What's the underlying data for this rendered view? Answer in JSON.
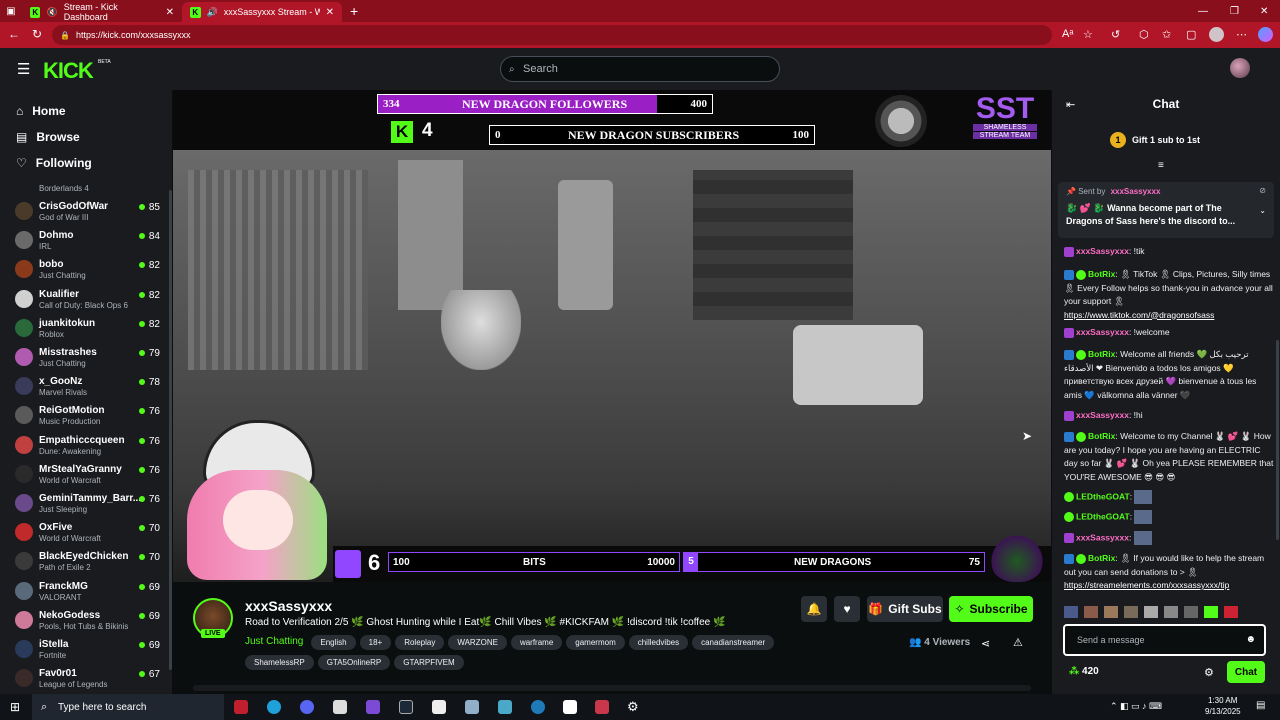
{
  "browser": {
    "tabs": [
      {
        "title": "Stream - Kick Dashboard",
        "active": false
      },
      {
        "title": "xxxSassyxxx Stream - Watch",
        "active": true
      }
    ],
    "url": "https://kick.com/xxxsassyxxx",
    "kick_fav": "K"
  },
  "header": {
    "logo": "KICK",
    "logo_badge": "BETA",
    "search_placeholder": "Search"
  },
  "sidebar": {
    "nav": [
      {
        "label": "Home",
        "icon": "home-icon"
      },
      {
        "label": "Browse",
        "icon": "browse-icon"
      },
      {
        "label": "Following",
        "icon": "heart-icon"
      }
    ],
    "partial_category": "Borderlands 4",
    "channels": [
      {
        "name": "CrisGodOfWar",
        "category": "God of War III",
        "viewers": "85"
      },
      {
        "name": "Dohmo",
        "category": "IRL",
        "viewers": "84"
      },
      {
        "name": "bobo",
        "category": "Just Chatting",
        "viewers": "82"
      },
      {
        "name": "Kualifier",
        "category": "Call of Duty: Black Ops 6",
        "viewers": "82"
      },
      {
        "name": "juankitokun",
        "category": "Roblox",
        "viewers": "82"
      },
      {
        "name": "Misstrashes",
        "category": "Just Chatting",
        "viewers": "79"
      },
      {
        "name": "x_GooNz",
        "category": "Marvel Rivals",
        "viewers": "78"
      },
      {
        "name": "ReiGotMotion",
        "category": "Music Production",
        "viewers": "76"
      },
      {
        "name": "Empathicccqueen",
        "category": "Dune: Awakening",
        "viewers": "76"
      },
      {
        "name": "MrStealYaGranny",
        "category": "World of Warcraft",
        "viewers": "76"
      },
      {
        "name": "GeminiTammy_Barr...",
        "category": "Just Sleeping",
        "viewers": "76"
      },
      {
        "name": "OxFive",
        "category": "World of Warcraft",
        "viewers": "70"
      },
      {
        "name": "BlackEyedChicken",
        "category": "Path of Exile 2",
        "viewers": "70"
      },
      {
        "name": "FranckMG",
        "category": "VALORANT",
        "viewers": "69"
      },
      {
        "name": "NekoGodess",
        "category": "Pools, Hot Tubs & Bikinis",
        "viewers": "69"
      },
      {
        "name": "iStella",
        "category": "Fortnite",
        "viewers": "69"
      },
      {
        "name": "Fav0r01",
        "category": "League of Legends",
        "viewers": "67"
      }
    ]
  },
  "overlay": {
    "followers_goal": {
      "current": "334",
      "label": "NEW DRAGON FOLLOWERS",
      "target": "400",
      "fraction": 0.835
    },
    "subs_goal": {
      "current": "0",
      "label": "NEW DRAGON SUBSCRIBERS",
      "target": "100",
      "fraction": 0
    },
    "kick_count": "4",
    "team_logo": "SST",
    "team_name_1": "SHAMELESS",
    "team_name_2": "STREAM TEAM",
    "twitch_count": "6",
    "bits_goal": {
      "current": "100",
      "label": "BITS",
      "target": "10000"
    },
    "dragons_goal": {
      "current": "5",
      "label": "NEW DRAGONS",
      "target": "75"
    }
  },
  "stream": {
    "streamer": "xxxSassyxxx",
    "title": "Road to Verification 2/5 🌿 Ghost Hunting while I Eat🌿 Chill Vibes 🌿 #KICKFAM 🌿 !discord !tik !coffee 🌿",
    "category": "Just Chatting",
    "live_badge": "LIVE",
    "tags_row1": [
      "English",
      "18+",
      "Roleplay",
      "WARZONE",
      "warframe",
      "gamermom",
      "chilledvibes",
      "canadianstreamer"
    ],
    "tags_row2": [
      "ShamelessRP",
      "GTA5OnlineRP",
      "GTARPFIVEM"
    ],
    "gift_label": "Gift Subs",
    "subscribe_label": "Subscribe",
    "viewers": "4 Viewers"
  },
  "chat": {
    "title": "Chat",
    "gift_prompt": "Gift 1 sub to 1st",
    "gift_count": "1",
    "pinned_sender_label": "Sent by",
    "pinned_sender": "xxxSassyxxx",
    "pinned_text": "🐉 💕 🐉 Wanna become part of The Dragons of Sass here's the discord to...",
    "messages": [
      {
        "user": "xxxSassyxxx",
        "color": "pink",
        "text": ": !tik"
      },
      {
        "user": "BotRix",
        "color": "green",
        "text": ": 🎗 TikTok 🎗 Clips, Pictures, Silly times 🎗 Every Follow helps so thank-you in advance your all your support 🎗",
        "link": "https://www.tiktok.com/@dragonsofsass"
      },
      {
        "user": "xxxSassyxxx",
        "color": "pink",
        "text": ": !welcome"
      },
      {
        "user": "BotRix",
        "color": "green",
        "text": ": Welcome all friends 💚 ترحيب بكل الأصدقاء ❤ Bienvenido a todos los amigos 💛 приветствую всех друзей 💜 bienvenue à tous les amis 💙 välkomna alla vänner 🖤"
      },
      {
        "user": "xxxSassyxxx",
        "color": "pink",
        "text": ": !hi"
      },
      {
        "user": "BotRix",
        "color": "green",
        "text": ": Welcome to my Channel 🐰 💕 🐰 How are you today? I hope you are having an ELECTRIC day so far 🐰 💕 🐰 Oh yea PLEASE REMEMBER that YOU'RE AWESOME 😎 😎 😎"
      },
      {
        "user": "LEDtheGOAT",
        "color": "green",
        "text": ":"
      },
      {
        "user": "LEDtheGOAT",
        "color": "green",
        "text": ":"
      },
      {
        "user": "xxxSassyxxx",
        "color": "pink",
        "text": ":"
      },
      {
        "user": "BotRix",
        "color": "green",
        "text": ": 🎗 If you would like to help the stream out you can send donations to > 🎗",
        "link": "https://streamelements.com/xxxsassyxxx/tip"
      }
    ],
    "input_placeholder": "Send a message",
    "points": "420",
    "send_label": "Chat"
  },
  "taskbar": {
    "search_placeholder": "Type here to search",
    "time": "1:30 AM",
    "date": "9/13/2025"
  }
}
